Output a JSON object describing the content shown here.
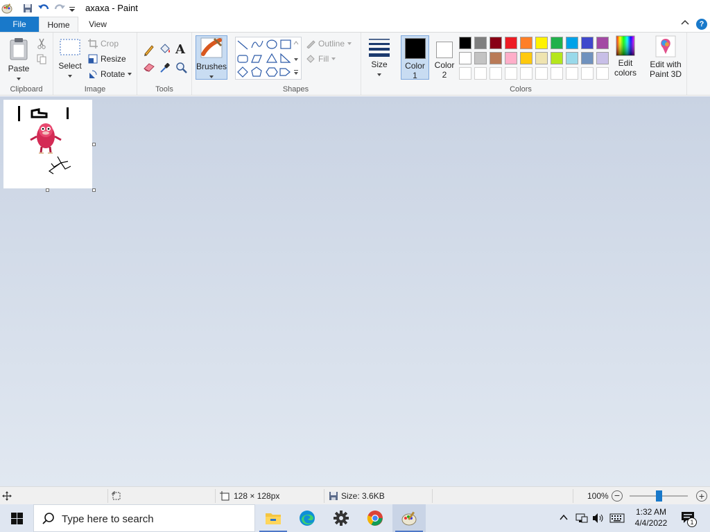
{
  "window": {
    "title": "axaxa - Paint"
  },
  "tabs": {
    "file": "File",
    "home": "Home",
    "view": "View"
  },
  "ribbon": {
    "clipboard": {
      "group_label": "Clipboard",
      "paste": "Paste"
    },
    "image": {
      "group_label": "Image",
      "select": "Select",
      "crop": "Crop",
      "resize": "Resize",
      "rotate": "Rotate"
    },
    "tools": {
      "group_label": "Tools"
    },
    "brushes": {
      "label": "Brushes"
    },
    "shapes": {
      "group_label": "Shapes",
      "outline": "Outline",
      "fill": "Fill"
    },
    "size": {
      "label": "Size"
    },
    "colors": {
      "group_label": "Colors",
      "color1_label": "Color",
      "color1_num": "1",
      "color2_label": "Color",
      "color2_num": "2",
      "edit_colors_line1": "Edit",
      "edit_colors_line2": "colors",
      "paint3d_line1": "Edit with",
      "paint3d_line2": "Paint 3D",
      "color1_value": "#000000",
      "color2_value": "#ffffff",
      "palette_row1": [
        "#000000",
        "#7f7f7f",
        "#880015",
        "#ed1c24",
        "#ff7f27",
        "#fff200",
        "#22b14c",
        "#00a2e8",
        "#3f48cc",
        "#a349a4"
      ],
      "palette_row2": [
        "#ffffff",
        "#c3c3c3",
        "#b97a57",
        "#ffaec9",
        "#ffc90e",
        "#efe4b0",
        "#b5e61d",
        "#99d9ea",
        "#7092be",
        "#c8bfe7"
      ]
    }
  },
  "status": {
    "dimensions": "128 × 128px",
    "size": "Size: 3.6KB",
    "zoom": "100%",
    "zoom_level_fraction": 0.5
  },
  "taskbar": {
    "search_placeholder": "Type here to search",
    "time": "1:32 AM",
    "date": "4/4/2022",
    "notification_count": "1"
  }
}
